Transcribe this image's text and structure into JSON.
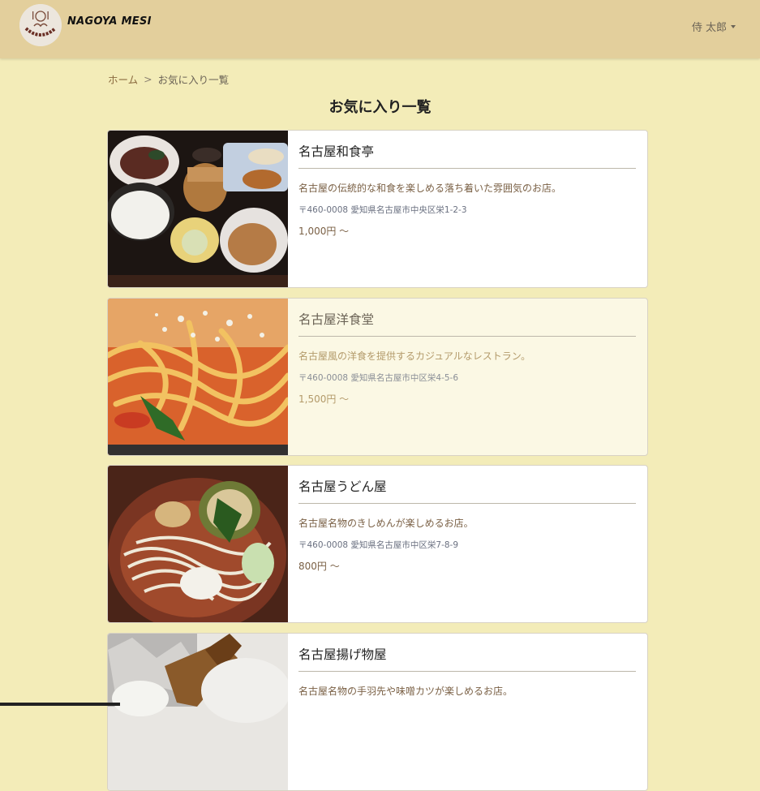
{
  "brand": {
    "name": "NAGOYA MESI",
    "logo_text": "NAGOYA"
  },
  "user": {
    "name": "侍 太郎"
  },
  "breadcrumb": {
    "home": "ホーム",
    "separator": ">",
    "current": "お気に入り一覧"
  },
  "page": {
    "title": "お気に入り一覧"
  },
  "restaurants": [
    {
      "name": "名古屋和食亭",
      "description": "名古屋の伝統的な和食を楽しめる落ち着いた雰囲気のお店。",
      "address": "〒460-0008 愛知県名古屋市中央区栄1-2-3",
      "price": "1,000円 〜",
      "image": "washoku-set"
    },
    {
      "name": "名古屋洋食堂",
      "description": "名古屋風の洋食を提供するカジュアルなレストラン。",
      "address": "〒460-0008 愛知県名古屋市中区栄4-5-6",
      "price": "1,500円 〜",
      "image": "spaghetti"
    },
    {
      "name": "名古屋うどん屋",
      "description": "名古屋名物のきしめんが楽しめるお店。",
      "address": "〒460-0008 愛知県名古屋市中区栄7-8-9",
      "price": "800円 〜",
      "image": "udon"
    },
    {
      "name": "名古屋揚げ物屋",
      "description": "名古屋名物の手羽先や味噌カツが楽しめるお店。",
      "address": "",
      "price": "",
      "image": "tebasaki"
    }
  ]
}
